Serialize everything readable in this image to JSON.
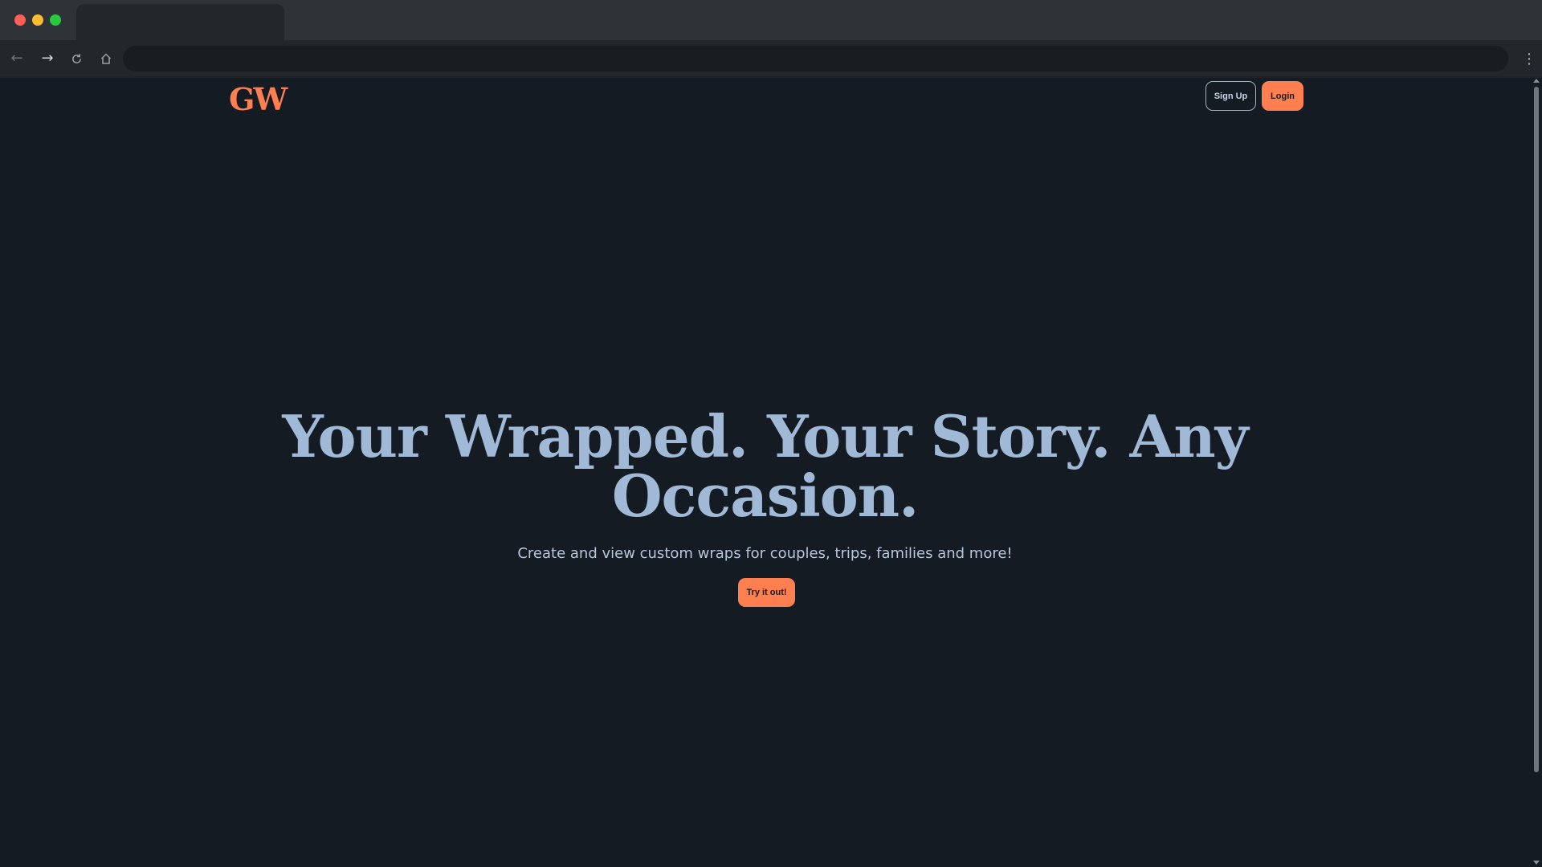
{
  "browser": {
    "tab_title": "",
    "url": "",
    "icons": [
      "back-icon",
      "forward-icon",
      "reload-icon",
      "home-icon",
      "menu-icon"
    ]
  },
  "header": {
    "logo_text": "GW",
    "signup_label": "Sign Up",
    "login_label": "Login"
  },
  "hero": {
    "title": "Your Wrapped. Your Story. Any Occasion.",
    "subtitle": "Create and view custom wraps for couples, trips, families and more!",
    "cta_label": "Try it out!"
  },
  "colors": {
    "accent": "#ff7f50",
    "background": "#151b22",
    "title": "#9fb9d7"
  }
}
